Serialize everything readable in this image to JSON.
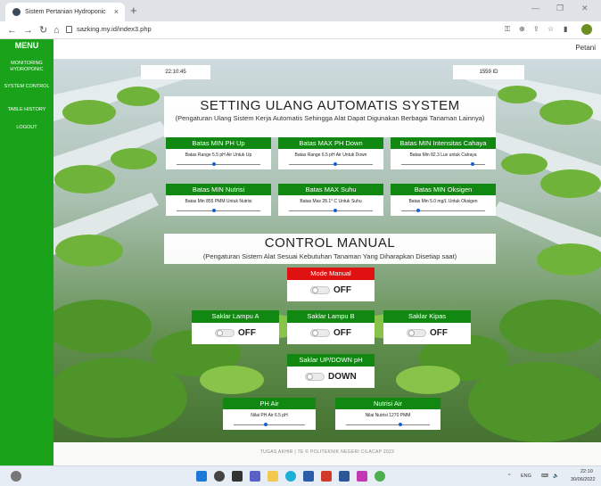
{
  "browser": {
    "tab_title": "Sistem Pertanian Hydroponic",
    "tab_close": "×",
    "new_tab": "+",
    "url": "sazking.my.id/index3.php",
    "win_minimize": "—",
    "win_restore": "❐",
    "win_close": "✕"
  },
  "header": {
    "user": "Petani"
  },
  "sidebar": {
    "title": "MENU",
    "items": [
      {
        "label": "MONITORING HYDROPONIC"
      },
      {
        "label": "SYSTEM CONTROL"
      },
      {
        "label": "TABLE HISTORY"
      },
      {
        "label": "LOGOUT"
      }
    ]
  },
  "info": {
    "time": "22:10:45",
    "id": "1559 ID"
  },
  "automatic": {
    "title": "SETTING ULANG AUTOMATIS SYSTEM",
    "subtitle": "(Pengaturan Ulang Sistem Kerja Automatis Sehingga Alat Dapat Digunakan Berbagai Tanaman Lainnya)",
    "cards": [
      {
        "label": "Batas MIN PH Up",
        "value": "Batas Range 5.5 pH Air Untuk Up",
        "level": 0.45
      },
      {
        "label": "Batas MAX PH Down",
        "value": "Batas Range 6.5 pH Air Untuk Down",
        "level": 0.55
      },
      {
        "label": "Batas MIN Intensitas Cahaya",
        "value": "Batas Min 82.3 Lux untuk Cahaya",
        "level": 0.85
      },
      {
        "label": "Batas MIN Nutrisi",
        "value": "Batas Min 855 PMM Untuk Nutrisi",
        "level": 0.45
      },
      {
        "label": "Batas MAX Suhu",
        "value": "Batas Max 28.1° C Untuk Suhu",
        "level": 0.55
      },
      {
        "label": "Batas MIN Oksigen",
        "value": "Batas Min 5.0 mg/L Untuk Oksigen",
        "level": 0.2
      }
    ]
  },
  "manual": {
    "title": "CONTROL MANUAL",
    "subtitle": "(Pengaturan Sistem Alat Sesuai Kebutuhan Tanaman Yang Diharapkan Disetiap saat)",
    "mode": {
      "label": "Mode Manual",
      "state": "OFF"
    },
    "switches": [
      {
        "label": "Saklar Lampu A",
        "state": "OFF"
      },
      {
        "label": "Saklar Lampu B",
        "state": "OFF"
      },
      {
        "label": "Saklar Kipas",
        "state": "OFF"
      }
    ],
    "updown": {
      "label": "Saklar UP/DOWN pH",
      "state": "DOWN"
    },
    "values": [
      {
        "label": "PH Air",
        "value": "Nilai PH Air 6.5 pH",
        "level": 0.45
      },
      {
        "label": "Nutrisi Air",
        "value": "Nilai Nutrisi 1270 PMM",
        "level": 0.65
      }
    ]
  },
  "footer": {
    "text": "TUGAS AKHIR | TE © POLITEKNIK NEGERI CILACAP 2022"
  },
  "taskbar": {
    "lang": "ENG",
    "time": "22:10",
    "date": "30/06/2022"
  }
}
